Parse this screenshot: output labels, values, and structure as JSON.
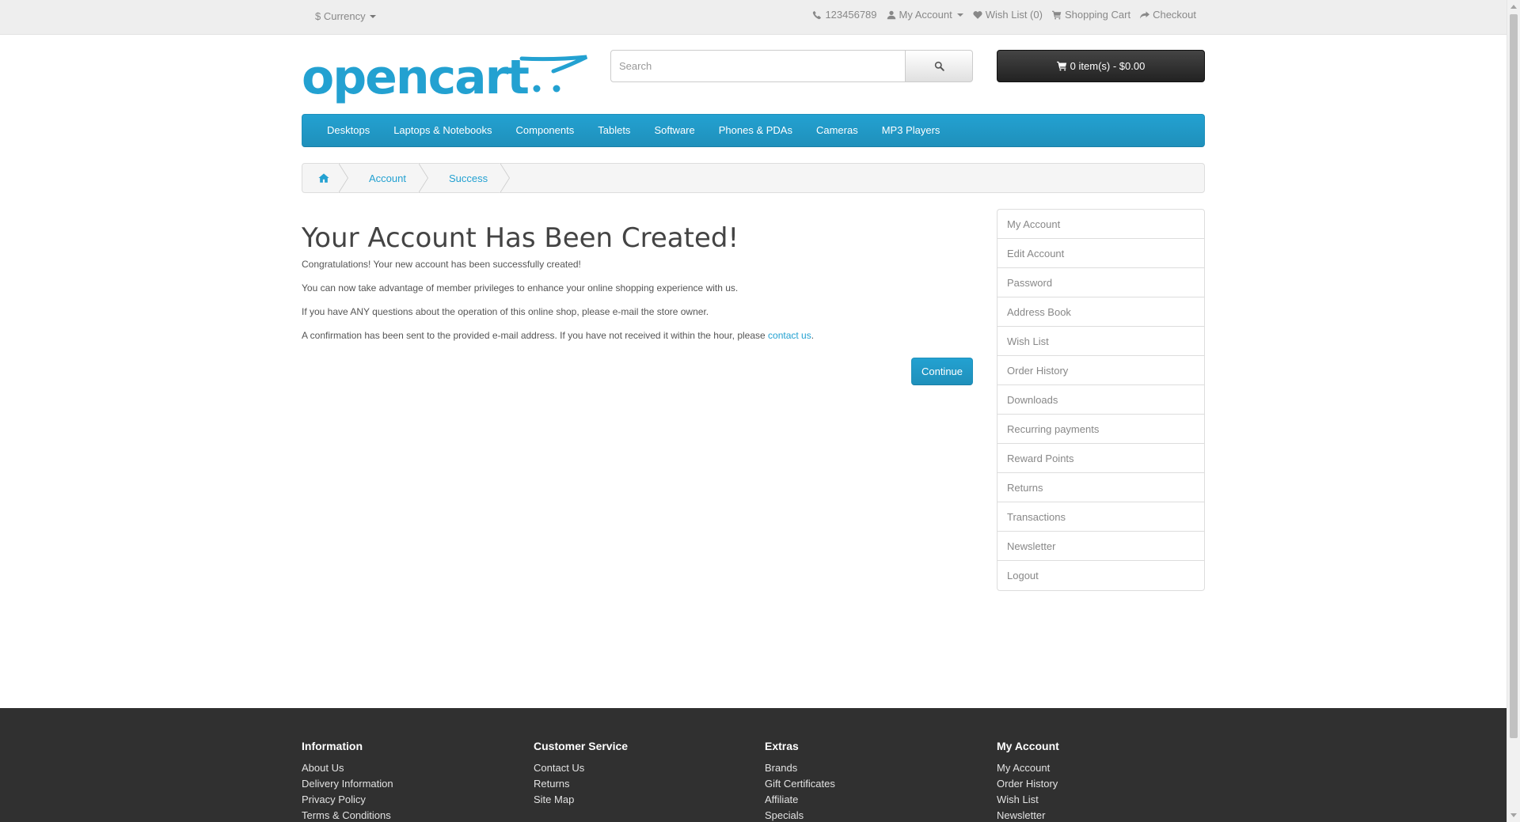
{
  "topbar": {
    "currency_label": "$ Currency",
    "phone": "123456789",
    "my_account": "My Account",
    "wish_list": "Wish List (0)",
    "shopping_cart": "Shopping Cart",
    "checkout": "Checkout"
  },
  "header": {
    "logo_text": "opencart",
    "search_placeholder": "Search",
    "cart_label": "0 item(s) - $0.00"
  },
  "menu": {
    "items": [
      "Desktops",
      "Laptops & Notebooks",
      "Components",
      "Tablets",
      "Software",
      "Phones & PDAs",
      "Cameras",
      "MP3 Players"
    ]
  },
  "breadcrumb": {
    "items": [
      "Account",
      "Success"
    ]
  },
  "content": {
    "title": "Your Account Has Been Created!",
    "p1": "Congratulations! Your new account has been successfully created!",
    "p2": "You can now take advantage of member privileges to enhance your online shopping experience with us.",
    "p3": "If you have ANY questions about the operation of this online shop, please e-mail the store owner.",
    "p4_prefix": "A confirmation has been sent to the provided e-mail address. If you have not received it within the hour, please ",
    "p4_link": "contact us",
    "p4_suffix": ".",
    "continue_label": "Continue"
  },
  "sidebar": {
    "items": [
      "My Account",
      "Edit Account",
      "Password",
      "Address Book",
      "Wish List",
      "Order History",
      "Downloads",
      "Recurring payments",
      "Reward Points",
      "Returns",
      "Transactions",
      "Newsletter",
      "Logout"
    ]
  },
  "footer": {
    "columns": [
      {
        "title": "Information",
        "links": [
          "About Us",
          "Delivery Information",
          "Privacy Policy",
          "Terms & Conditions"
        ]
      },
      {
        "title": "Customer Service",
        "links": [
          "Contact Us",
          "Returns",
          "Site Map"
        ]
      },
      {
        "title": "Extras",
        "links": [
          "Brands",
          "Gift Certificates",
          "Affiliate",
          "Specials"
        ]
      },
      {
        "title": "My Account",
        "links": [
          "My Account",
          "Order History",
          "Wish List",
          "Newsletter"
        ]
      }
    ]
  },
  "colors": {
    "accent": "#23a1d1",
    "footer_bg": "#303030",
    "cart_bg": "#222222",
    "topbar_bg": "#eeeeee"
  }
}
